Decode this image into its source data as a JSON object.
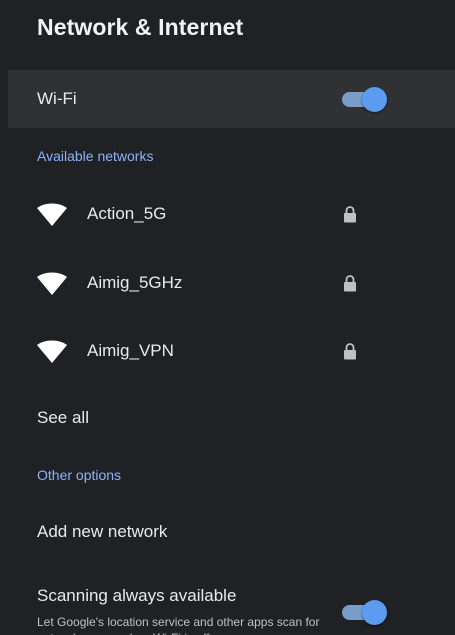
{
  "header": {
    "title": "Network & Internet"
  },
  "wifi": {
    "label": "Wi-Fi",
    "enabled": true
  },
  "available_networks": {
    "header": "Available networks",
    "items": [
      {
        "name": "Action_5G",
        "secured": true,
        "icon": "wifi-icon"
      },
      {
        "name": "Aimig_5GHz",
        "secured": true,
        "icon": "wifi-icon"
      },
      {
        "name": "Aimig_VPN",
        "secured": true,
        "icon": "wifi-icon"
      }
    ],
    "see_all_label": "See all"
  },
  "other_options": {
    "header": "Other options",
    "add_network_label": "Add new network",
    "scanning": {
      "title": "Scanning always available",
      "description": "Let Google's location service and other apps scan for networks, even when Wi-Fi is off",
      "enabled": true
    }
  },
  "colors": {
    "background": "#202124",
    "highlight_row": "#303134",
    "accent": "#8ab4f8",
    "toggle_thumb": "#5b9bf0",
    "toggle_track": "#7a9cc9"
  }
}
